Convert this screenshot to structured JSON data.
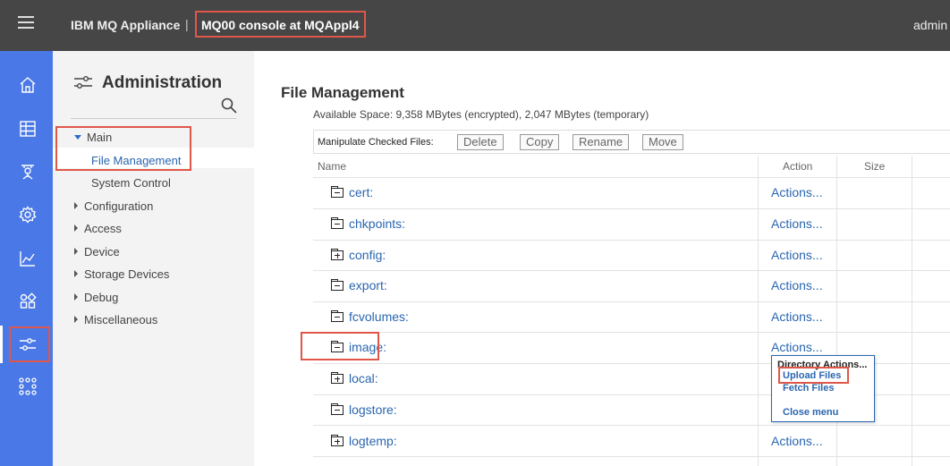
{
  "header": {
    "product": "IBM MQ Appliance",
    "separator": "|",
    "console_title": "MQ00 console at MQAppl4",
    "user": "admin"
  },
  "rail": {
    "icons": [
      "home-icon",
      "table-icon",
      "queue-manager-icon",
      "gear-icon",
      "chart-icon",
      "apps-icon",
      "sliders-icon",
      "network-icon"
    ],
    "active": "sliders-icon"
  },
  "nav": {
    "title": "Administration",
    "items": [
      {
        "label": "Main",
        "expanded": true
      },
      {
        "label": "File Management",
        "selected": true
      },
      {
        "label": "System Control"
      },
      {
        "label": "Configuration"
      },
      {
        "label": "Access"
      },
      {
        "label": "Device"
      },
      {
        "label": "Storage Devices"
      },
      {
        "label": "Debug"
      },
      {
        "label": "Miscellaneous"
      }
    ]
  },
  "main": {
    "title": "File Management",
    "available_space": "Available Space: 9,358 MBytes (encrypted), 2,047 MBytes (temporary)",
    "toolbar": {
      "label": "Manipulate Checked Files:",
      "delete": "Delete",
      "copy": "Copy",
      "rename": "Rename",
      "move": "Move"
    },
    "columns": {
      "name": "Name",
      "action": "Action",
      "size": "Size"
    },
    "rows": [
      {
        "name": "cert:",
        "action": "Actions...",
        "folder": "open"
      },
      {
        "name": "chkpoints:",
        "action": "Actions...",
        "folder": "open"
      },
      {
        "name": "config:",
        "action": "Actions...",
        "folder": "closed"
      },
      {
        "name": "export:",
        "action": "Actions...",
        "folder": "open"
      },
      {
        "name": "fcvolumes:",
        "action": "Actions...",
        "folder": "open"
      },
      {
        "name": "image:",
        "action": "Actions...",
        "folder": "open"
      },
      {
        "name": "local:",
        "action": "",
        "folder": "closed"
      },
      {
        "name": "logstore:",
        "action": "",
        "folder": "open"
      },
      {
        "name": "logtemp:",
        "action": "Actions...",
        "folder": "closed"
      }
    ]
  },
  "popup": {
    "heading": "Directory Actions...",
    "items": [
      "Upload Files",
      "Fetch Files",
      "Close menu"
    ]
  },
  "colors": {
    "topbar": "#464646",
    "rail": "#4a78e6",
    "link": "#2a66b0",
    "highlight": "#e0574a"
  }
}
